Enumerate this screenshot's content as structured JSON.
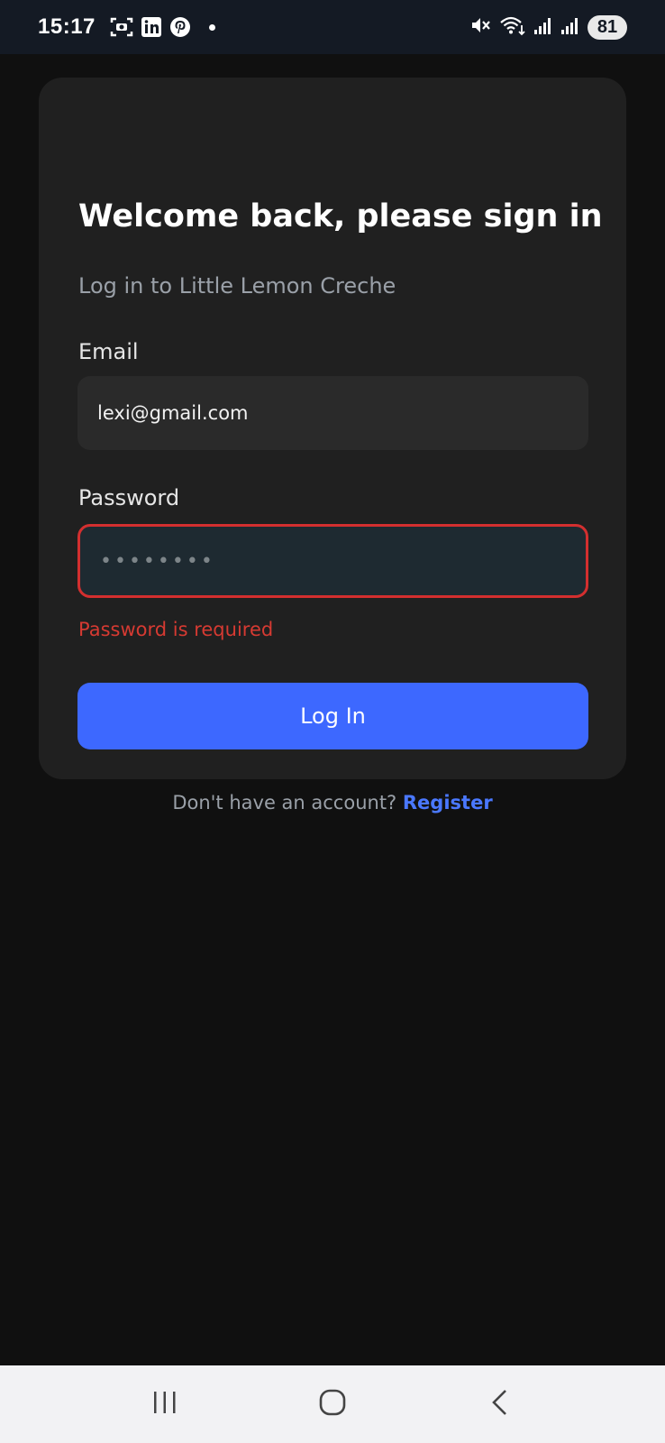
{
  "status_bar": {
    "time": "15:17",
    "battery": "81",
    "icons": [
      "screenshot-icon",
      "linkedin-icon",
      "pinterest-icon",
      "notification-dot",
      "mute-icon",
      "wifi-icon",
      "signal-icon",
      "signal-icon"
    ]
  },
  "login": {
    "title": "Welcome back, please sign in",
    "subtitle": "Log in to Little Lemon Creche",
    "email_label": "Email",
    "email_value": "lexi@gmail.com",
    "password_label": "Password",
    "password_value": "••••••••",
    "password_error": "Password is required",
    "login_button": "Log In",
    "register_prompt": "Don't have an account?",
    "register_link": "Register"
  },
  "colors": {
    "background": "#101010",
    "card": "#202020",
    "accent": "#3d68ff",
    "error": "#d32f2f",
    "link": "#4a78ff"
  },
  "nav_bar": {
    "buttons": [
      "recents-icon",
      "home-icon",
      "back-icon"
    ]
  }
}
